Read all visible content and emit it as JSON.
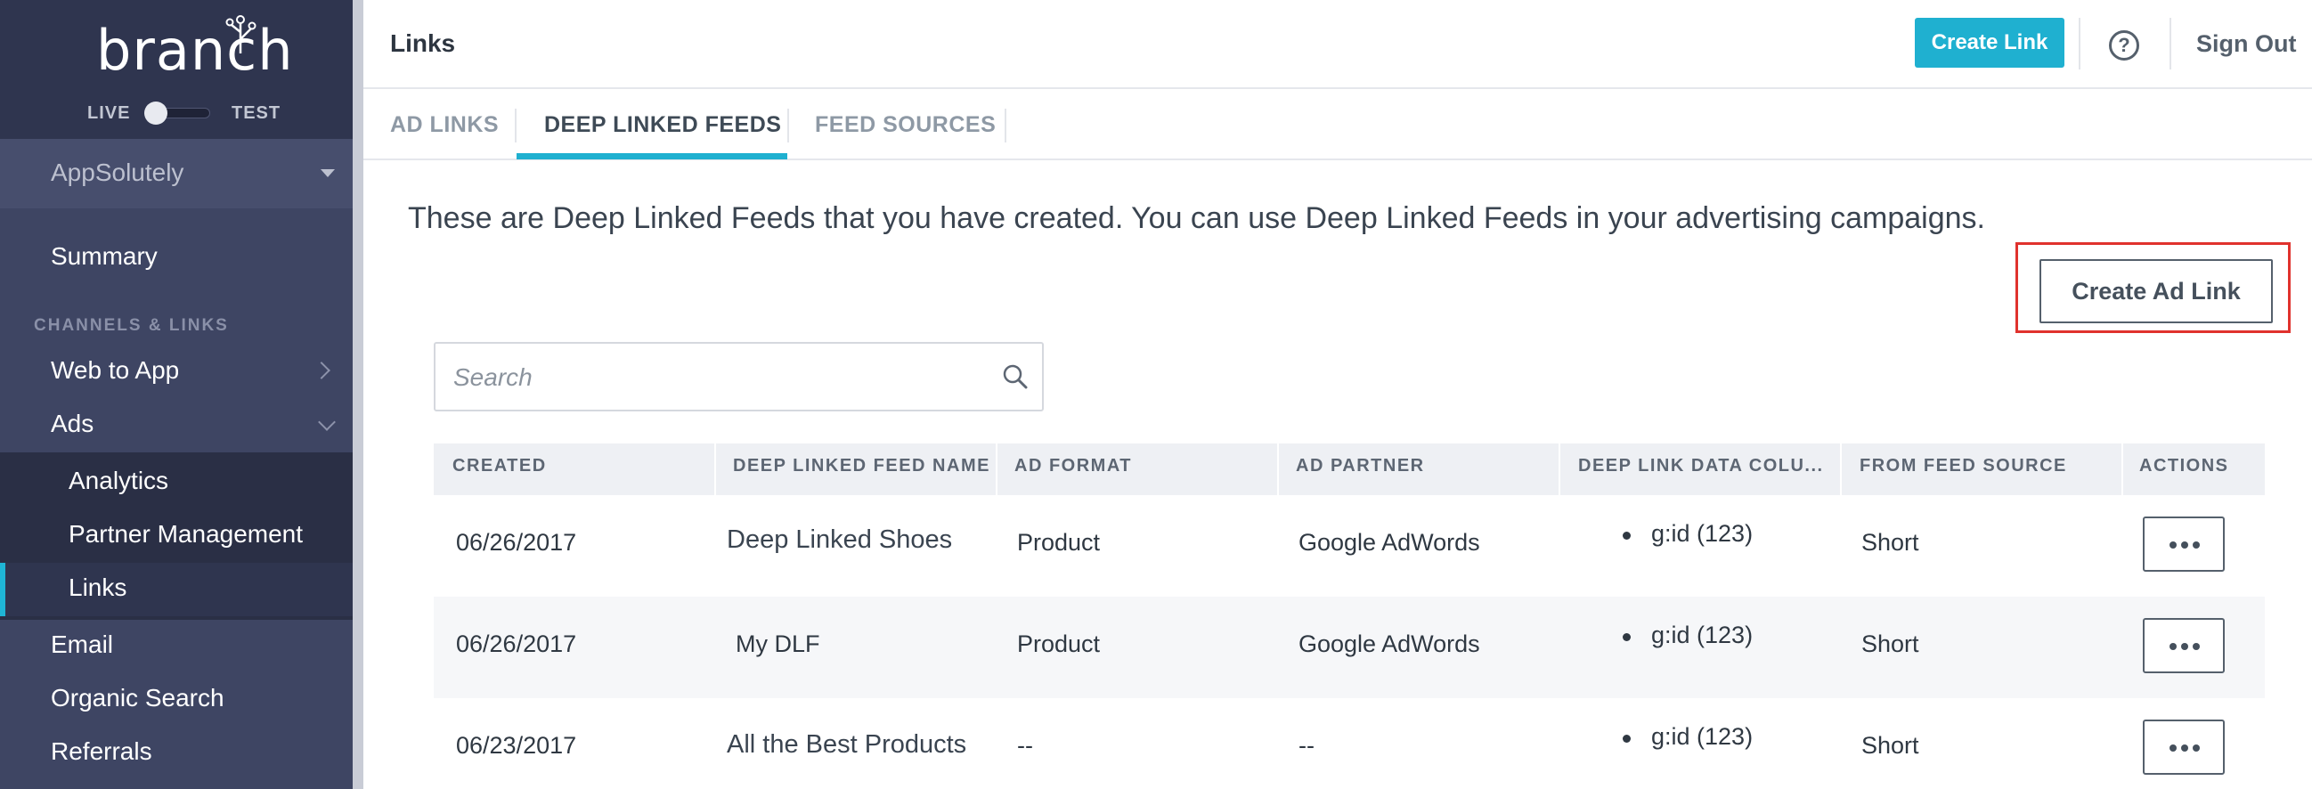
{
  "sidebar": {
    "logo": "branch",
    "env_live": "LIVE",
    "env_test": "TEST",
    "app_name": "AppSolutely",
    "summary": "Summary",
    "section_title": "CHANNELS & LINKS",
    "items": [
      {
        "label": "Web to App"
      },
      {
        "label": "Ads"
      },
      {
        "label": "Analytics"
      },
      {
        "label": "Partner Management"
      },
      {
        "label": "Links"
      },
      {
        "label": "Email"
      },
      {
        "label": "Organic Search"
      },
      {
        "label": "Referrals"
      }
    ]
  },
  "header": {
    "title": "Links",
    "create_link": "Create Link",
    "help": "?",
    "sign_out": "Sign Out"
  },
  "tabs": [
    {
      "label": "AD LINKS",
      "active": false
    },
    {
      "label": "DEEP LINKED FEEDS",
      "active": true
    },
    {
      "label": "FEED SOURCES",
      "active": false
    }
  ],
  "main": {
    "intro": "These are Deep Linked Feeds that you have created. You can use Deep Linked Feeds in your advertising campaigns.",
    "create_ad_link": "Create Ad Link",
    "search_placeholder": "Search"
  },
  "table": {
    "columns": [
      "CREATED",
      "DEEP LINKED FEED NAME",
      "AD FORMAT",
      "AD PARTNER",
      "DEEP LINK DATA COLU...",
      "FROM FEED SOURCE",
      "ACTIONS"
    ],
    "rows": [
      {
        "created": "06/26/2017",
        "name": "Deep Linked Shoes",
        "format": "Product",
        "partner": "Google AdWords",
        "data": "g:id (123)",
        "source": "Short"
      },
      {
        "created": "06/26/2017",
        "name": "My DLF",
        "format": "Product",
        "partner": "Google AdWords",
        "data": "g:id (123)",
        "source": "Short"
      },
      {
        "created": "06/23/2017",
        "name": "All the Best Products",
        "format": "--",
        "partner": "--",
        "data": "g:id (123)",
        "source": "Short"
      }
    ]
  },
  "colors": {
    "accent": "#1fb0d0",
    "sidebar": "#3e4563",
    "highlight": "#e0322d"
  }
}
